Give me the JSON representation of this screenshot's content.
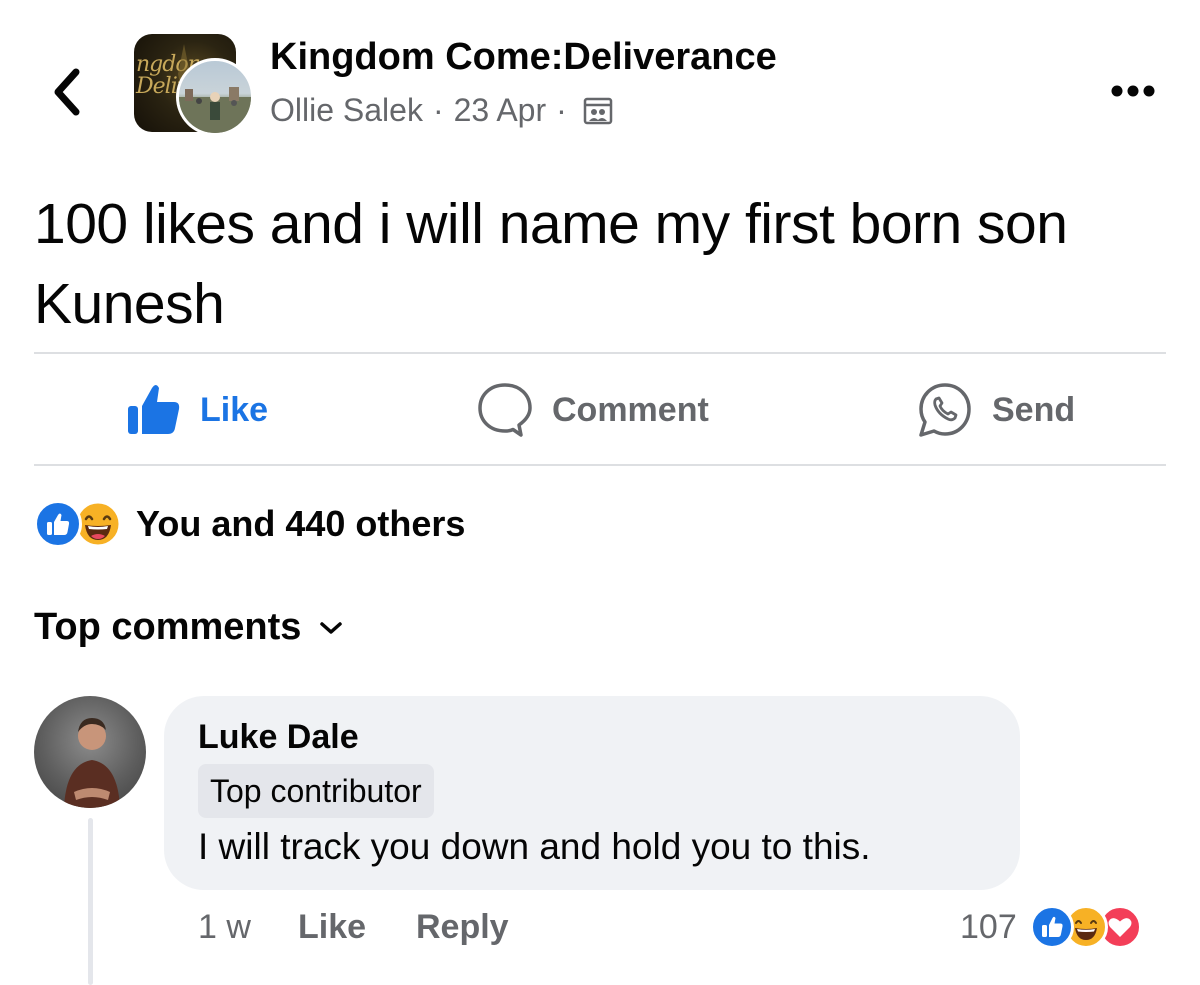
{
  "header": {
    "group_name": "Kingdom Come:Deliverance",
    "avatar_text": "Kingdom\nDeliv",
    "author": "Ollie Salek",
    "separator": "·",
    "date": "23 Apr",
    "audience_icon": "group-audience-icon",
    "more_icon": "more-options-icon",
    "back_icon": "chevron-left-icon"
  },
  "post": {
    "text": "100 likes and i will name my first born son Kunesh"
  },
  "actions": {
    "like_label": "Like",
    "comment_label": "Comment",
    "send_label": "Send"
  },
  "reactions": {
    "summary": "You and 440 others",
    "types": [
      "like",
      "haha"
    ]
  },
  "comments_section": {
    "sort_label": "Top comments"
  },
  "comment": {
    "author": "Luke Dale",
    "badge": "Top contributor",
    "text": "I will track you down and hold you to this.",
    "time": "1 w",
    "like_label": "Like",
    "reply_label": "Reply",
    "reaction_count": "107",
    "reaction_types": [
      "like",
      "haha",
      "love"
    ]
  },
  "colors": {
    "brand_blue": "#1b74e4",
    "secondary_text": "#65676b",
    "divider": "#dddfe2",
    "bubble": "#f0f2f5",
    "love_red": "#f33e58",
    "haha_yellow": "#f7b125"
  }
}
